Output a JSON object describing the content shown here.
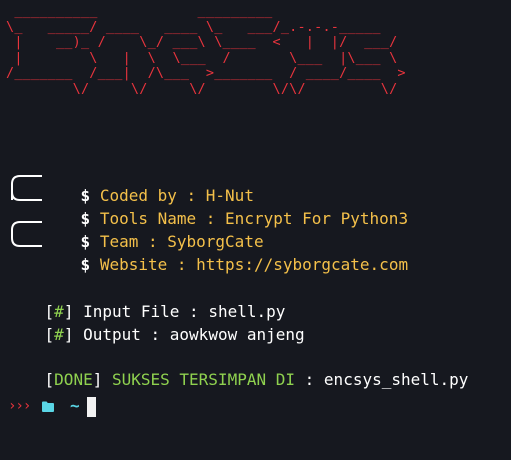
{
  "banner": {
    "art": " __________            _________\n\\_   _____/ ____   ____ \\_   ___/_.-.-.-_____\n |    __)_ /    \\_/ ___\\ \\____  <   |  |/  ___/\n |        \\   |  \\  \\___  /       \\___  |\\___ \\\n/_______  /___|  /\\___  >_______  / ____/____  >\n        \\/     \\/     \\/        \\/\\/         \\/",
    "color": "#e8343d"
  },
  "info": {
    "prompt_symbol": "$",
    "lines": [
      {
        "label": "Coded by",
        "value": "H-Nut"
      },
      {
        "label": "Tools Name",
        "value": "Encrypt For Python3"
      },
      {
        "label": "Team",
        "value": "SyborgCate"
      },
      {
        "label": "Website",
        "value": "https://syborgcate.com"
      }
    ],
    "separator": " : ",
    "color": "#f4c04a"
  },
  "inputs": {
    "tag": "#",
    "input_label": "Input File",
    "input_value": "shell.py",
    "output_label": "Output",
    "output_value": "aowkwow anjeng"
  },
  "result": {
    "status": "DONE",
    "message": "SUKSES TERSIMPAN DI",
    "separator": ":",
    "filename": "encsys_shell.py"
  },
  "prompt": {
    "arrows": "›››",
    "folder_icon": "folder-icon",
    "tilde": "~",
    "colors": {
      "arrows": "#e8343d",
      "folder": "#5ad6e6"
    }
  }
}
